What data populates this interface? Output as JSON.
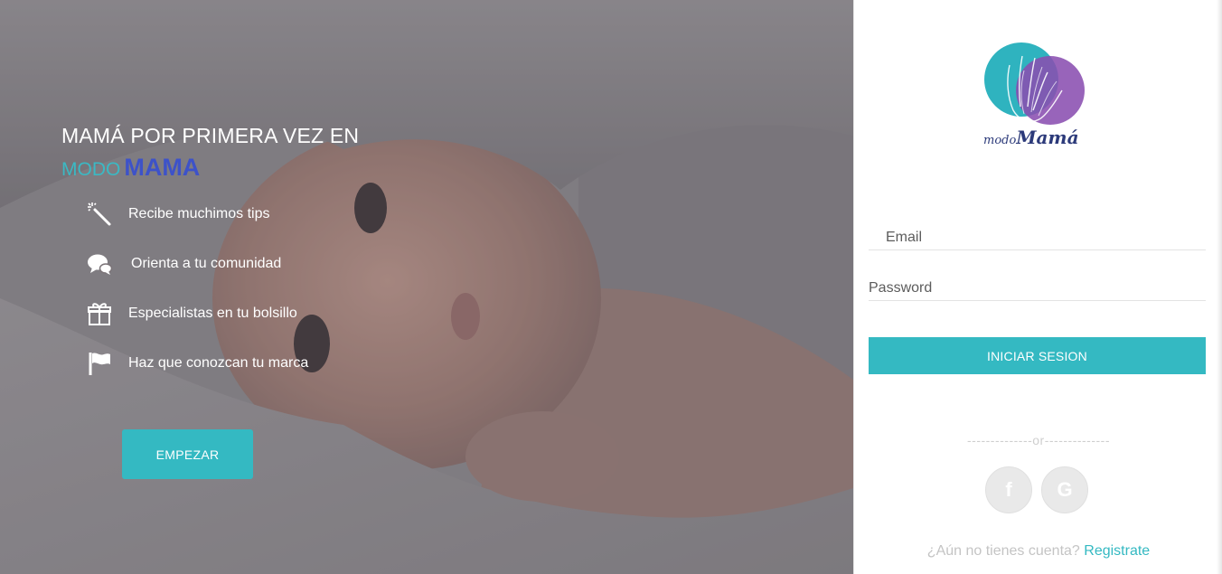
{
  "colors": {
    "accent": "#34b9c2",
    "brand_blue": "#3d52c9",
    "logo_teal": "#2fb3bf",
    "logo_purple": "#8a4fb0"
  },
  "hero": {
    "title": "MAMÁ POR PRIMERA VEZ EN",
    "brand_prefix": "MODO",
    "brand_name": "MAMA",
    "features": [
      {
        "icon": "magic-wand-icon",
        "label": "Recibe muchimos tips"
      },
      {
        "icon": "chat-bubbles-icon",
        "label": "Orienta a tu comunidad"
      },
      {
        "icon": "gift-icon",
        "label": "Especialistas en tu bolsillo"
      },
      {
        "icon": "flag-icon",
        "label": "Haz que conozcan tu marca"
      }
    ],
    "cta_label": "EMPEZAR"
  },
  "login": {
    "logo_text_a": "modo",
    "logo_text_b": "Mamá",
    "email_placeholder": "Email",
    "password_placeholder": "Password",
    "submit_label": "INICIAR SESION",
    "divider": "--------------or--------------",
    "facebook_label": "f",
    "google_label": "G",
    "signup_prompt": "¿Aún no tienes cuenta?",
    "signup_link": "Registrate"
  }
}
